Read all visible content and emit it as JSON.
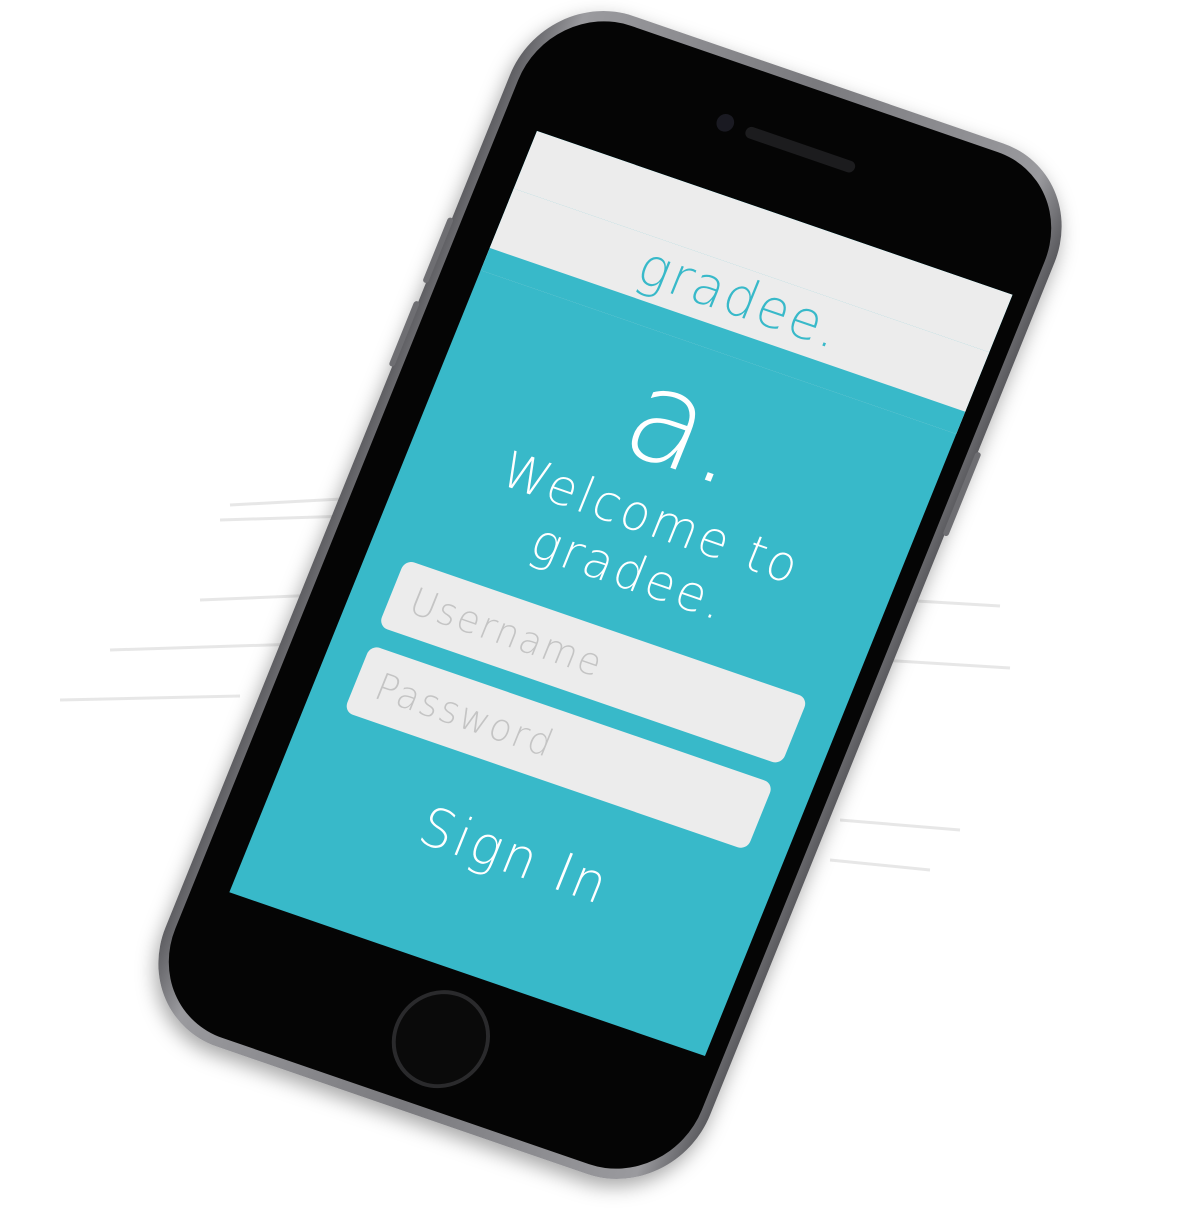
{
  "app": {
    "brand": "gradee.",
    "logo_glyph": "a.",
    "welcome_line1": "Welcome to",
    "welcome_line2": "gradee."
  },
  "login": {
    "username_placeholder": "Username",
    "password_placeholder": "Password",
    "sign_in_label": "Sign In"
  },
  "colors": {
    "accent": "#38b9c9",
    "bar": "#ececec",
    "field_placeholder": "#c4c4c4",
    "phone_body": "#7a7a7e"
  },
  "icons": [
    "home-button-icon",
    "camera-icon",
    "speaker-icon"
  ]
}
